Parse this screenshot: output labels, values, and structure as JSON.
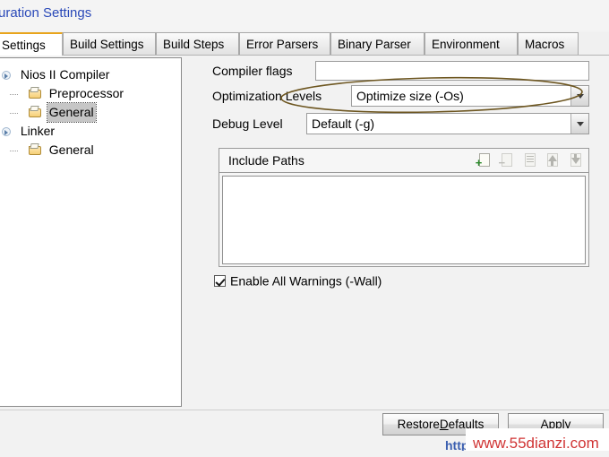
{
  "window": {
    "title": "uration Settings"
  },
  "tabs": [
    {
      "label": "Settings",
      "active": true
    },
    {
      "label": "Build Settings",
      "active": false
    },
    {
      "label": "Build Steps",
      "active": false
    },
    {
      "label": "Error Parsers",
      "active": false
    },
    {
      "label": "Binary Parser",
      "active": false
    },
    {
      "label": "Environment",
      "active": false
    },
    {
      "label": "Macros",
      "active": false
    }
  ],
  "tree": {
    "items": [
      {
        "label": "Nios II Compiler",
        "icon": "expand-toggle-icon",
        "level": 0,
        "selected": false
      },
      {
        "label": "Preprocessor",
        "icon": "folder-icon",
        "level": 1,
        "selected": false
      },
      {
        "label": "General",
        "icon": "folder-icon",
        "level": 1,
        "selected": true
      },
      {
        "label": "Linker",
        "icon": "expand-toggle-icon",
        "level": 0,
        "selected": false
      },
      {
        "label": "General",
        "icon": "folder-icon",
        "level": 1,
        "selected": false
      }
    ]
  },
  "form": {
    "compiler_flags": {
      "label": "Compiler flags",
      "value": "",
      "placeholder": ""
    },
    "optimization_levels": {
      "label": "Optimization Levels",
      "value": "Optimize size (-Os)"
    },
    "debug_level": {
      "label": "Debug Level",
      "value": "Default (-g)"
    },
    "include_paths": {
      "title": "Include Paths",
      "items": [],
      "tools": [
        {
          "name": "add-include-path-icon",
          "enabled": true
        },
        {
          "name": "remove-include-path-icon",
          "enabled": false
        },
        {
          "name": "edit-include-path-icon",
          "enabled": false
        },
        {
          "name": "move-up-icon",
          "enabled": false
        },
        {
          "name": "move-down-icon",
          "enabled": false
        }
      ]
    },
    "enable_all_warnings": {
      "label": "Enable All Warnings (-Wall)",
      "checked": true
    }
  },
  "footer": {
    "restore_defaults": {
      "prefix": "Restore ",
      "mnemonic": "D",
      "suffix": "efaults"
    },
    "apply": "Apply"
  },
  "annotation": {
    "shape": "ellipse",
    "color": "#6d5620",
    "target": "Optimization Levels"
  },
  "watermark": {
    "prefix": "http",
    "text": "www.55dianzi.com",
    "color": "#d03434"
  }
}
